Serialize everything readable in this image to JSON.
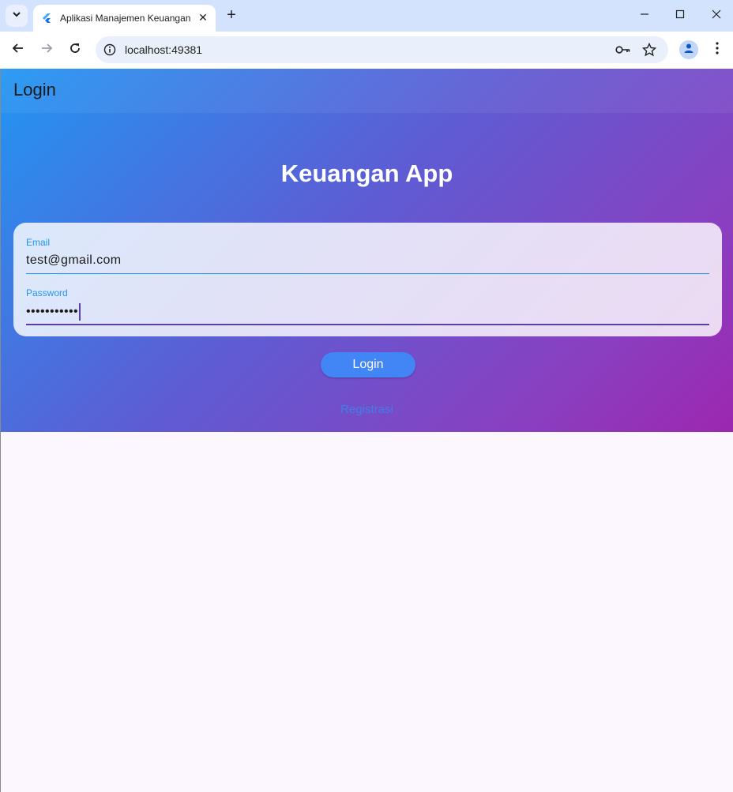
{
  "browser": {
    "tab_title": "Aplikasi Manajemen Keuangan",
    "url": "localhost:49381",
    "icons": [
      "tab-search-icon",
      "flutter-icon",
      "close-icon",
      "plus-icon",
      "minimize-icon",
      "maximize-icon",
      "window-close-icon",
      "back-icon",
      "forward-icon",
      "reload-icon",
      "info-icon",
      "key-icon",
      "star-icon",
      "profile-icon",
      "kebab-menu-icon"
    ]
  },
  "appbar": {
    "title": "Login"
  },
  "main": {
    "title": "Keuangan App",
    "email": {
      "label": "Email",
      "value": "test@gmail.com"
    },
    "password": {
      "label": "Password",
      "value": "•••••••••••"
    },
    "login_label": "Login",
    "register_label": "Registrasi"
  },
  "colors": {
    "gradient_start": "#2196f3",
    "gradient_end": "#9c27b0",
    "button": "#4285f4",
    "field_label": "#2196f3",
    "focus": "#5b3fa6"
  }
}
